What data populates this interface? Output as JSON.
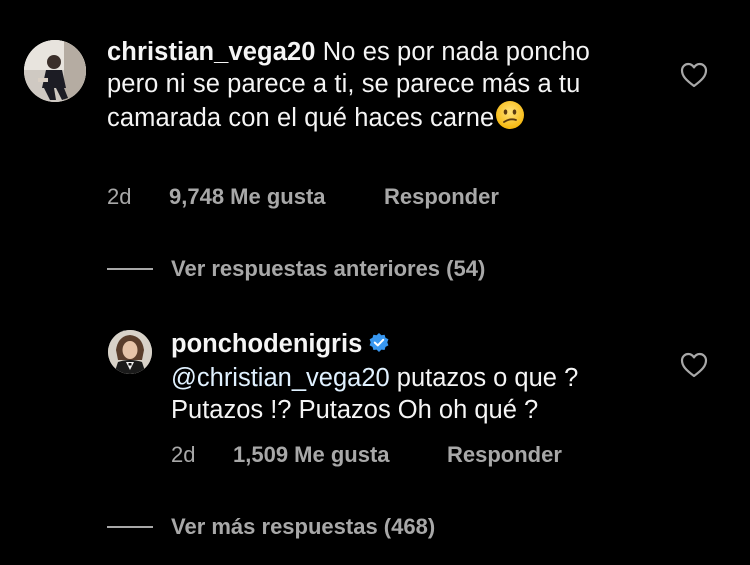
{
  "comments": [
    {
      "username": "christian_vega20",
      "text": "No es por nada poncho pero ni se parece a ti, se parece más a tu camarada con el qué haces carne",
      "emoji": "confused-face",
      "time": "2d",
      "likes": "9,748 Me gusta",
      "reply_label": "Responder",
      "view_replies": "Ver respuestas anteriores (54)"
    },
    {
      "username": "ponchodenigris",
      "verified": true,
      "mention": "@christian_vega20",
      "text_line1": " putazos o que ?",
      "text_line2": "Putazos !? Putazos Oh oh qué ?",
      "time": "2d",
      "likes": "1,509 Me gusta",
      "reply_label": "Responder",
      "view_replies": "Ver más respuestas (468)"
    }
  ],
  "colors": {
    "background": "#000000",
    "primary_text": "#f5f5f5",
    "secondary_text": "#a8a8a8",
    "mention": "#e0f1ff",
    "verified_badge": "#3897f0"
  },
  "icons": {
    "like": "heart-outline-icon",
    "verified": "verified-badge-icon"
  }
}
